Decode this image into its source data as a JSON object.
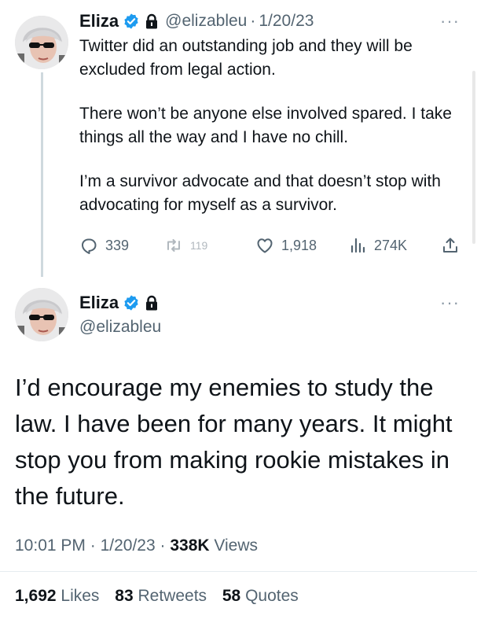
{
  "tweet1": {
    "name": "Eliza",
    "handle": "@elizableu",
    "separator": "·",
    "date": "1/20/23",
    "paragraphs": [
      "Twitter did an outstanding job and they will be excluded from legal action.",
      "There won’t be anyone else involved spared. I take things all the way and I have no chill.",
      "I’m a survivor advocate and that doesn’t stop with advocating for myself as a survivor."
    ],
    "actions": {
      "replies": "339",
      "retweets": "119",
      "likes": "1,918",
      "views": "274K"
    },
    "menu": "···"
  },
  "tweet2": {
    "name": "Eliza",
    "handle": "@elizableu",
    "menu": "···",
    "text": "I’d encourage my enemies to study the law. I have been for many years. It might stop you from making rookie mistakes in the future.",
    "time": "10:01 PM",
    "date": "1/20/23",
    "separator": "·",
    "views_count": "338K",
    "views_label": "Views",
    "likes_count": "1,692",
    "likes_label": "Likes",
    "retweets_count": "83",
    "retweets_label": "Retweets",
    "quotes_count": "58",
    "quotes_label": "Quotes"
  },
  "colors": {
    "text": "#0f1419",
    "muted": "#536471",
    "verified": "#1d9bf0",
    "thread_line": "#cfd9de"
  },
  "icons": [
    "verified-badge-icon",
    "lock-icon",
    "reply-icon",
    "retweet-icon",
    "like-icon",
    "views-icon",
    "share-icon",
    "more-icon"
  ]
}
